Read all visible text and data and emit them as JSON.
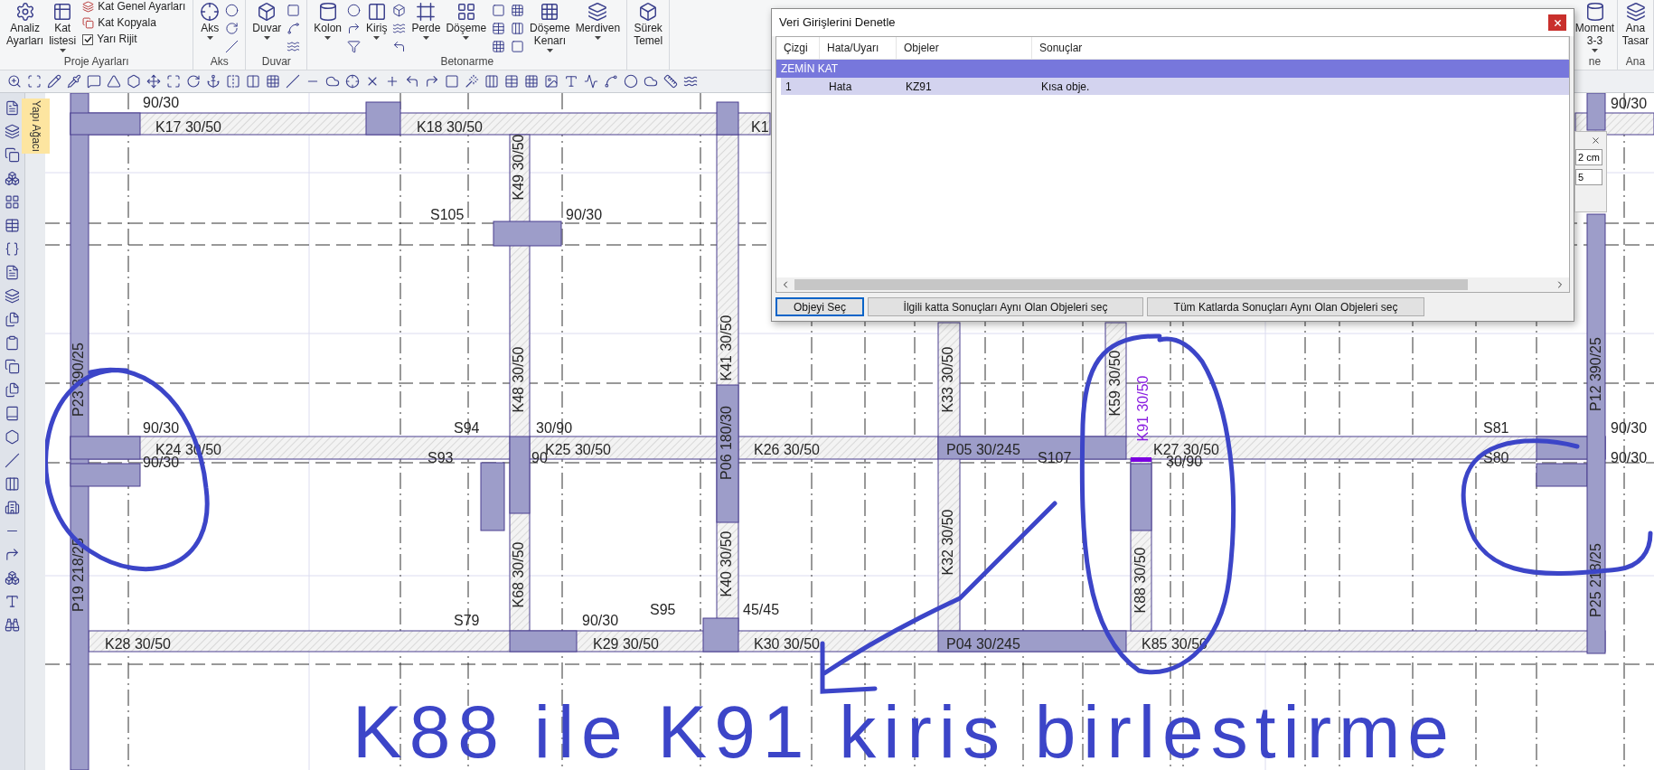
{
  "ribbon": {
    "groups": [
      {
        "label": "Proje Ayarları",
        "items": [
          {
            "kind": "large",
            "lines": [
              "Analiz",
              "Ayarları"
            ],
            "dropdown": false
          },
          {
            "kind": "large",
            "lines": [
              "Kat",
              "listesi"
            ],
            "dropdown": true
          },
          {
            "kind": "stack",
            "entries": [
              {
                "kind": "small",
                "label": "Kat Genel Ayarları"
              },
              {
                "kind": "small",
                "label": "Kat Kopyala"
              },
              {
                "kind": "check",
                "label": "Yarı Rijit",
                "checked": true
              }
            ]
          }
        ]
      },
      {
        "label": "Aks",
        "items": [
          {
            "kind": "large",
            "lines": [
              "Aks"
            ],
            "dropdown": true
          },
          {
            "kind": "icons"
          }
        ]
      },
      {
        "label": "Duvar",
        "items": [
          {
            "kind": "large",
            "lines": [
              "Duvar"
            ],
            "dropdown": true
          },
          {
            "kind": "icons"
          }
        ]
      },
      {
        "label": "Betonarme",
        "items": [
          {
            "kind": "large",
            "lines": [
              "Kolon"
            ],
            "dropdown": true
          },
          {
            "kind": "icons"
          },
          {
            "kind": "large",
            "lines": [
              "Kiriş"
            ],
            "dropdown": true
          },
          {
            "kind": "icons"
          },
          {
            "kind": "large",
            "lines": [
              "Perde"
            ],
            "dropdown": true
          },
          {
            "kind": "large",
            "lines": [
              "Döşeme"
            ],
            "dropdown": true
          },
          {
            "kind": "icons"
          },
          {
            "kind": "icons"
          },
          {
            "kind": "large",
            "lines": [
              "Döşeme",
              "Kenarı"
            ],
            "dropdown": true
          },
          {
            "kind": "large",
            "lines": [
              "Merdiven"
            ],
            "dropdown": true
          }
        ]
      },
      {
        "items": [
          {
            "kind": "large",
            "lines": [
              "Sürek",
              "Temel"
            ],
            "dropdown": false
          }
        ]
      }
    ],
    "right_groups": [
      {
        "label": "ne",
        "items": [
          {
            "kind": "large",
            "lines": [
              "Moment",
              "3-3"
            ],
            "dropdown": true
          }
        ]
      },
      {
        "label": "Ana",
        "items": [
          {
            "kind": "large",
            "lines": [
              "Ana",
              "Tasar"
            ],
            "dropdown": false
          }
        ]
      }
    ]
  },
  "side_tab": {
    "label": "Yapı Ağacı"
  },
  "plan": {
    "labels": [
      {
        "text": "90/30",
        "selected": false
      },
      {
        "text": "K17 30/50",
        "selected": false
      },
      {
        "text": "K18 30/50",
        "selected": false
      },
      {
        "text": "K1",
        "selected": false
      },
      {
        "text": "K49 30/50",
        "selected": false
      },
      {
        "text": "S105",
        "selected": false
      },
      {
        "text": "90/30",
        "selected": false
      },
      {
        "text": "K41 30/50",
        "selected": false
      },
      {
        "text": "P23 390/25",
        "selected": false
      },
      {
        "text": "K48 30/50",
        "selected": false
      },
      {
        "text": "K33 30/50",
        "selected": false
      },
      {
        "text": "K59 30/50",
        "selected": false
      },
      {
        "text": "K91 30/50",
        "selected": true
      },
      {
        "text": "P12 390/25",
        "selected": false
      },
      {
        "text": "90/30",
        "selected": false
      },
      {
        "text": "S94",
        "selected": false
      },
      {
        "text": "30/90",
        "selected": false
      },
      {
        "text": "S81",
        "selected": false
      },
      {
        "text": "90/30",
        "selected": false
      },
      {
        "text": "K24 30/50",
        "selected": false
      },
      {
        "text": "K25 30/50",
        "selected": false
      },
      {
        "text": "K26 30/50",
        "selected": false
      },
      {
        "text": "P05 30/245",
        "selected": false
      },
      {
        "text": "K27 30/50",
        "selected": false
      },
      {
        "text": "90/30",
        "selected": false
      },
      {
        "text": "S93",
        "selected": false
      },
      {
        "text": "90",
        "selected": false
      },
      {
        "text": "S107",
        "selected": false
      },
      {
        "text": "30/90",
        "selected": false
      },
      {
        "text": "S80",
        "selected": false
      },
      {
        "text": "90/30",
        "selected": false
      },
      {
        "text": "P06 180/30",
        "selected": false
      },
      {
        "text": "P19 218/25",
        "selected": false
      },
      {
        "text": "K68 30/50",
        "selected": false
      },
      {
        "text": "K40 30/50",
        "selected": false
      },
      {
        "text": "K32 30/50",
        "selected": false
      },
      {
        "text": "K88 30/50",
        "selected": false
      },
      {
        "text": "P25 218/25",
        "selected": false
      },
      {
        "text": "S95",
        "selected": false
      },
      {
        "text": "45/45",
        "selected": false
      },
      {
        "text": "S79",
        "selected": false
      },
      {
        "text": "90/30",
        "selected": false
      },
      {
        "text": "K28 30/50",
        "selected": false
      },
      {
        "text": "K29 30/50",
        "selected": false
      },
      {
        "text": "K30 30/50",
        "selected": false
      },
      {
        "text": "P04 30/245",
        "selected": false
      },
      {
        "text": "K85 30/50",
        "selected": false
      },
      {
        "text": "90/30",
        "selected": false
      }
    ]
  },
  "annotation": {
    "text": "K88 ile K91 kiris birlestirme"
  },
  "side_panel": {
    "fields": [
      {
        "value": "2 cm"
      },
      {
        "value": "5"
      }
    ]
  },
  "dialog": {
    "title": "Veri Girişlerini Denetle",
    "columns": [
      "Çizgi",
      "Hata/Uyarı",
      "Objeler",
      "Sonuçlar"
    ],
    "groups": [
      {
        "label": "ZEMİN KAT",
        "rows": [
          {
            "cells": [
              "1",
              "Hata",
              "KZ91",
              "Kısa obje."
            ],
            "selected": true
          }
        ]
      }
    ],
    "buttons": [
      {
        "label": "Objeyi Seç",
        "focused": true
      },
      {
        "label": "İlgili katta Sonuçları Aynı Olan Objeleri seç",
        "focused": false
      },
      {
        "label": "Tüm Katlarda Sonuçları Aynı Olan Objeleri seç",
        "focused": false
      }
    ]
  }
}
